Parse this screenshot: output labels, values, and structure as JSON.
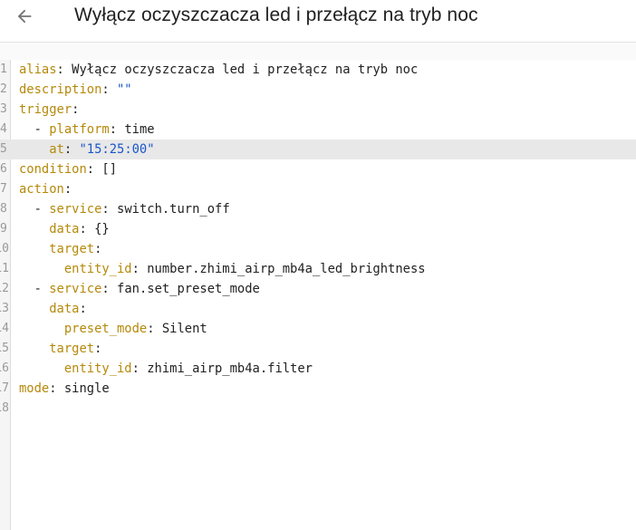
{
  "header": {
    "title": "Wyłącz oczyszczacza led i przełącz na tryb noc",
    "back_icon": "arrow-left-icon"
  },
  "colors": {
    "key": "#b5890a",
    "string": "#1a57c9",
    "text": "#212121"
  },
  "editor": {
    "active_line": 5,
    "lines": [
      {
        "num": "1",
        "indent": "",
        "dash": "",
        "key": "alias",
        "sep": ": ",
        "value": "Wyłącz oczyszczacza led i przełącz na tryb noc",
        "value_type": "plain"
      },
      {
        "num": "2",
        "indent": "",
        "dash": "",
        "key": "description",
        "sep": ": ",
        "value": "\"\"",
        "value_type": "string"
      },
      {
        "num": "3",
        "indent": "",
        "dash": "",
        "key": "trigger",
        "sep": ":",
        "value": "",
        "value_type": "plain"
      },
      {
        "num": "4",
        "indent": "  ",
        "dash": "- ",
        "key": "platform",
        "sep": ": ",
        "value": "time",
        "value_type": "plain"
      },
      {
        "num": "5",
        "indent": "    ",
        "dash": "",
        "key": "at",
        "sep": ": ",
        "value": "\"15:25:00\"",
        "value_type": "string"
      },
      {
        "num": "6",
        "indent": "",
        "dash": "",
        "key": "condition",
        "sep": ": ",
        "value": "[]",
        "value_type": "plain"
      },
      {
        "num": "7",
        "indent": "",
        "dash": "",
        "key": "action",
        "sep": ":",
        "value": "",
        "value_type": "plain"
      },
      {
        "num": "8",
        "indent": "  ",
        "dash": "- ",
        "key": "service",
        "sep": ": ",
        "value": "switch.turn_off",
        "value_type": "plain"
      },
      {
        "num": "9",
        "indent": "    ",
        "dash": "",
        "key": "data",
        "sep": ": ",
        "value": "{}",
        "value_type": "plain"
      },
      {
        "num": "10",
        "indent": "    ",
        "dash": "",
        "key": "target",
        "sep": ":",
        "value": "",
        "value_type": "plain"
      },
      {
        "num": "11",
        "indent": "      ",
        "dash": "",
        "key": "entity_id",
        "sep": ": ",
        "value": "number.zhimi_airp_mb4a_led_brightness",
        "value_type": "plain"
      },
      {
        "num": "12",
        "indent": "  ",
        "dash": "- ",
        "key": "service",
        "sep": ": ",
        "value": "fan.set_preset_mode",
        "value_type": "plain"
      },
      {
        "num": "13",
        "indent": "    ",
        "dash": "",
        "key": "data",
        "sep": ":",
        "value": "",
        "value_type": "plain"
      },
      {
        "num": "14",
        "indent": "      ",
        "dash": "",
        "key": "preset_mode",
        "sep": ": ",
        "value": "Silent",
        "value_type": "plain"
      },
      {
        "num": "15",
        "indent": "    ",
        "dash": "",
        "key": "target",
        "sep": ":",
        "value": "",
        "value_type": "plain"
      },
      {
        "num": "16",
        "indent": "      ",
        "dash": "",
        "key": "entity_id",
        "sep": ": ",
        "value": "zhimi_airp_mb4a.filter",
        "value_type": "plain"
      },
      {
        "num": "17",
        "indent": "",
        "dash": "",
        "key": "mode",
        "sep": ": ",
        "value": "single",
        "value_type": "plain"
      },
      {
        "num": "18",
        "indent": "",
        "dash": "",
        "key": "",
        "sep": "",
        "value": "",
        "value_type": "plain"
      }
    ]
  }
}
